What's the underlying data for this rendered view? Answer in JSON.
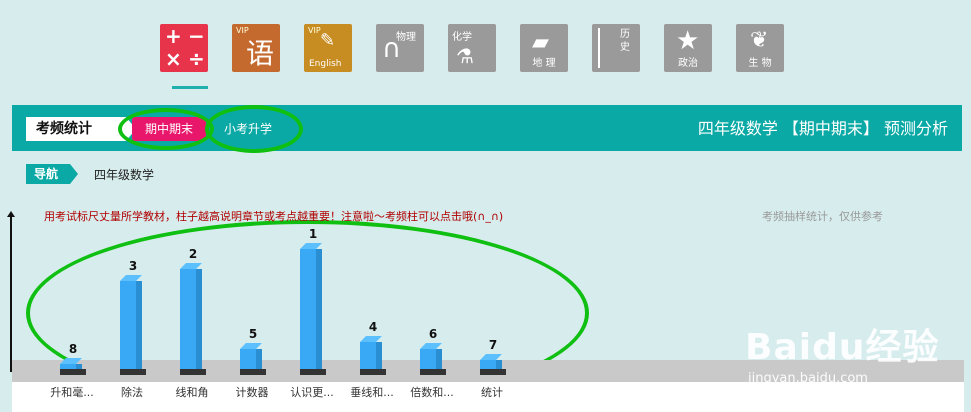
{
  "subjects": [
    {
      "icon": "math-icon",
      "color": "#e8344b",
      "label": "",
      "active": true
    },
    {
      "icon": "chinese-icon",
      "color": "#c46a2e",
      "label": "语",
      "badge": "VIP"
    },
    {
      "icon": "english-icon",
      "color": "#c78c22",
      "label": "English",
      "badge": "VIP"
    },
    {
      "icon": "physics-icon",
      "color": "#9a9a9a",
      "label": "物理"
    },
    {
      "icon": "chemistry-icon",
      "color": "#9a9a9a",
      "label": "化学"
    },
    {
      "icon": "geography-icon",
      "color": "#9a9a9a",
      "label": "地 理"
    },
    {
      "icon": "history-icon",
      "color": "#9a9a9a",
      "label": "历史"
    },
    {
      "icon": "politics-icon",
      "color": "#9a9a9a",
      "label": "政治"
    },
    {
      "icon": "biology-icon",
      "color": "#9a9a9a",
      "label": "生 物"
    }
  ],
  "header": {
    "tab": "考频统计",
    "exam_tab": "期中期末",
    "sub_tab": "小考升学",
    "title": "四年级数学 【期中期末】 预测分析"
  },
  "nav": {
    "tag": "导航",
    "path": "四年级数学"
  },
  "note": "用考试标尺丈量所学教材，柱子越高说明章节或考点越重要！注意啦～考频柱可以点击哦(∩_∩)",
  "note_right": "考频抽样统计，仅供参考",
  "chart_data": {
    "type": "bar",
    "categories": [
      "升和毫...",
      "除法",
      "线和角",
      "计数器",
      "认识更...",
      "垂线和...",
      "倍数和...",
      "统计"
    ],
    "ranks": [
      "8",
      "3",
      "2",
      "5",
      "1",
      "4",
      "6",
      "7"
    ],
    "values": [
      5,
      88,
      100,
      20,
      120,
      27,
      20,
      9
    ]
  },
  "watermark": {
    "brand": "Baidu经验",
    "url": "jingyan.baidu.com"
  },
  "colors": {
    "accent": "#0aa9a6",
    "pill": "#e8176b",
    "bar": "#3aa9f5",
    "highlight": "#0fbf11"
  }
}
